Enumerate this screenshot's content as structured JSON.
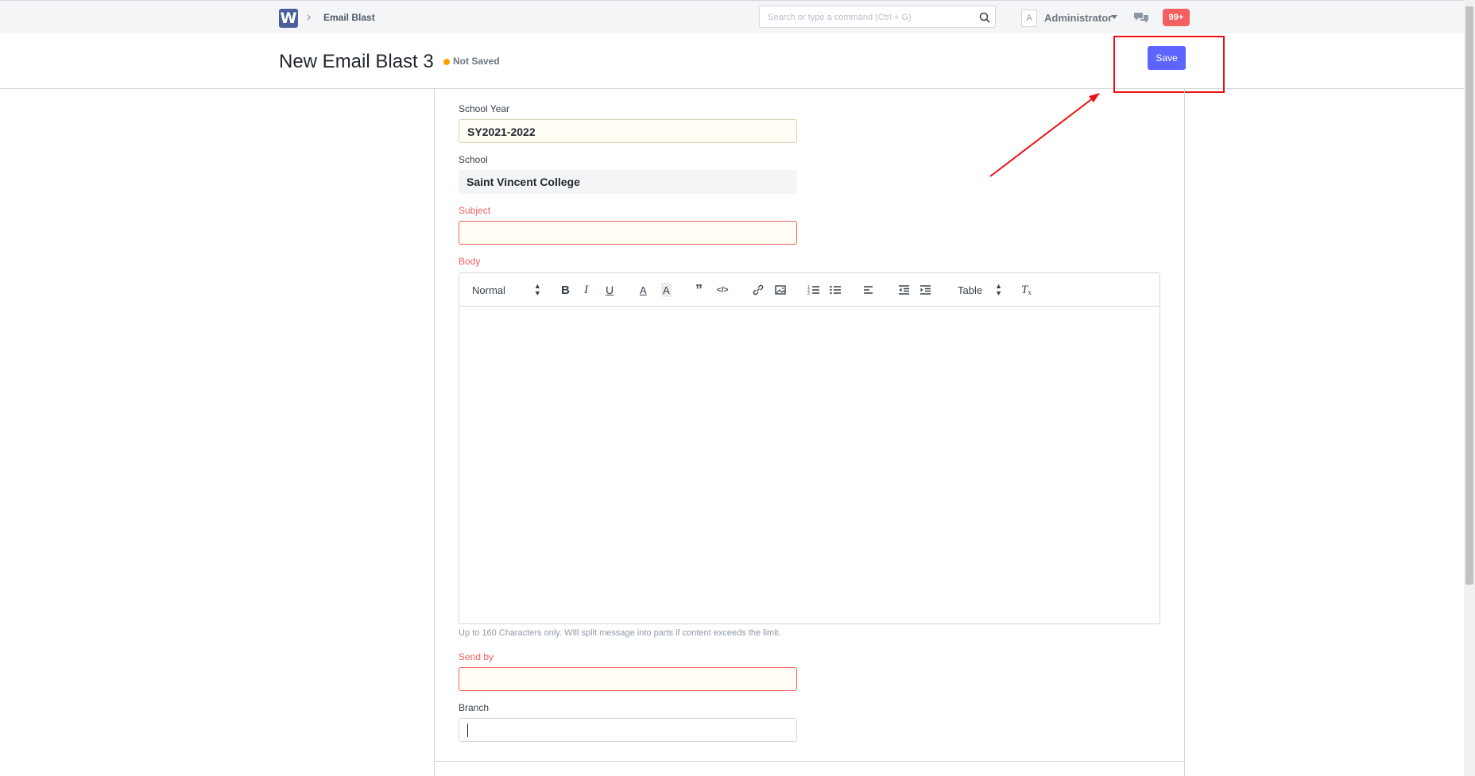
{
  "navbar": {
    "logo_letter": "W",
    "breadcrumb": "Email Blast",
    "search_placeholder": "Search or type a command (Ctrl + G)",
    "avatar_letter": "A",
    "user_name": "Administrator",
    "notification_count": "99+"
  },
  "page": {
    "title": "New Email Blast 3",
    "status": "Not Saved",
    "status_color": "#ff9f00",
    "save_label": "Save",
    "accent_color": "#5e64ff"
  },
  "form": {
    "school_year": {
      "label": "School Year",
      "value": "SY2021-2022"
    },
    "school": {
      "label": "School",
      "value": "Saint Vincent College"
    },
    "subject": {
      "label": "Subject",
      "value": ""
    },
    "body": {
      "label": "Body",
      "toolbar": {
        "format": "Normal",
        "table": "Table"
      },
      "help": "Up to 160 Characters only. WIll split message into parts if content exceeds the limit."
    },
    "send_by": {
      "label": "Send by",
      "value": ""
    },
    "branch": {
      "label": "Branch",
      "value": ""
    }
  }
}
